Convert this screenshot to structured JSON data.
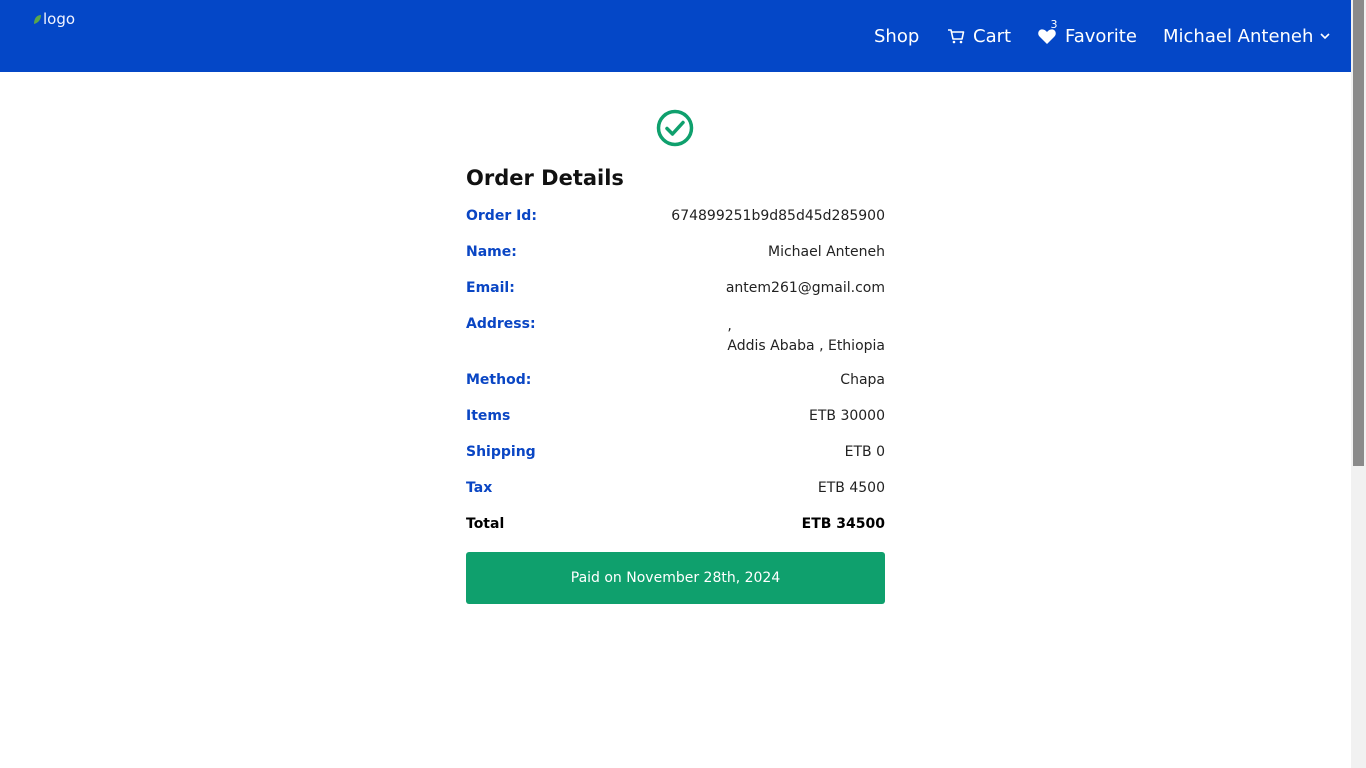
{
  "navbar": {
    "logo_alt": "logo",
    "shop_label": "Shop",
    "cart_label": "Cart",
    "favorite_label": "Favorite",
    "favorite_count": "3",
    "user_name": "Michael Anteneh",
    "colors": {
      "background": "#0447c7",
      "text": "#ffffff"
    }
  },
  "order": {
    "title": "Order Details",
    "order_id_label": "Order Id:",
    "order_id": "674899251b9d85d45d285900",
    "name_label": "Name:",
    "name": "Michael Anteneh",
    "email_label": "Email:",
    "email": "antem261@gmail.com",
    "address_label": "Address:",
    "address_line1": ",",
    "address_line2": "Addis Ababa , Ethiopia",
    "method_label": "Method:",
    "method": "Chapa",
    "items_label": "Items",
    "items_value": "ETB 30000",
    "shipping_label": "Shipping",
    "shipping_value": "ETB 0",
    "tax_label": "Tax",
    "tax_value": "ETB 4500",
    "total_label": "Total",
    "total_value": "ETB 34500",
    "paid_status": "Paid on November 28th, 2024",
    "colors": {
      "label": "#0a46c4",
      "paid_bar": "#0fa06d",
      "check": "#0fa06d"
    }
  }
}
